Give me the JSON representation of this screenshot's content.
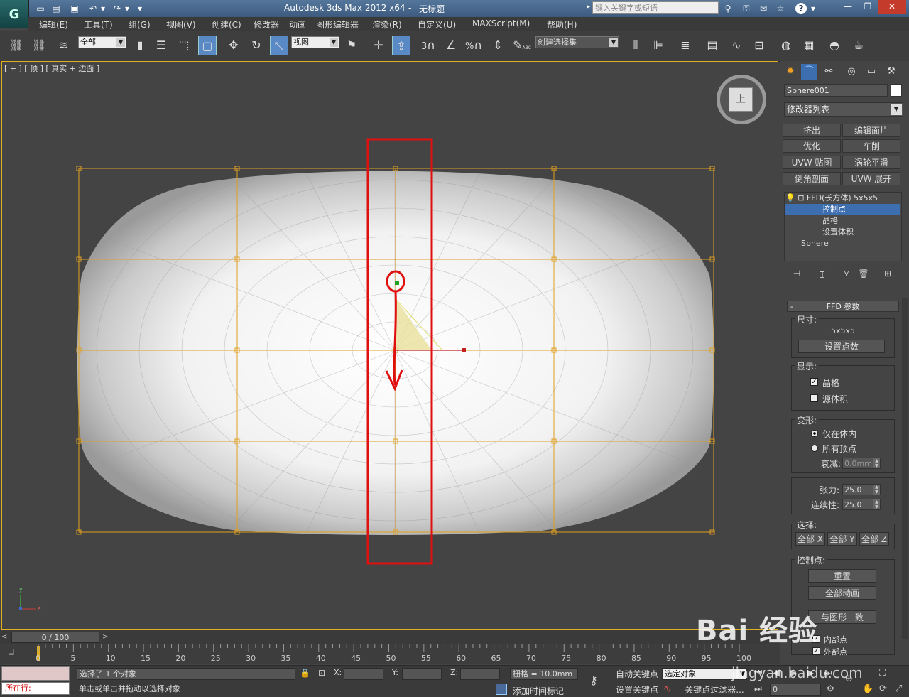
{
  "title_bar": {
    "app_title": "Autodesk 3ds Max  2012 x64",
    "separator": "-",
    "document_name": "无标题",
    "search_placeholder": "键入关键字或短语",
    "help_label": "?"
  },
  "menu": [
    "编辑(E)",
    "工具(T)",
    "组(G)",
    "视图(V)",
    "创建(C)",
    "修改器",
    "动画",
    "图形编辑器",
    "渲染(R)",
    "自定义(U)",
    "MAXScript(M)",
    "帮助(H)"
  ],
  "toolbar": {
    "selection_filter": "全部",
    "ref_coord": "视图",
    "snap_labels": [
      "3",
      "%"
    ],
    "named_selection": "创建选择集",
    "abc_label": "ABC"
  },
  "viewport": {
    "label": "[ + ] [ 顶 ] [ 真实 + 边面 ]",
    "viewcube_label": "上",
    "axis_labels": [
      "y",
      "x"
    ]
  },
  "command_panel": {
    "object_name": "Sphere001",
    "object_color": "#ffffff",
    "modifier_list": "修改器列表",
    "modifier_buttons": [
      "挤出",
      "编辑面片",
      "优化",
      "车削",
      "UVW 贴图",
      "涡轮平滑",
      "倒角剖面",
      "UVW 展开"
    ],
    "stack": {
      "modifier": "FFD(长方体) 5x5x5",
      "sub_objects": [
        "控制点",
        "晶格",
        "设置体积"
      ],
      "selected_sub": "控制点",
      "base": "Sphere"
    },
    "rollout_title": "FFD 参数",
    "dimensions": {
      "label": "尺寸:",
      "value": "5x5x5",
      "button": "设置点数"
    },
    "display": {
      "label": "显示:",
      "lattice": "晶格",
      "lattice_checked": true,
      "source_volume": "源体积",
      "source_checked": false
    },
    "deform": {
      "label": "变形:",
      "only_in_volume": "仅在体内",
      "all_vertices": "所有顶点",
      "falloff_label": "衰减:",
      "falloff": "0.0mm"
    },
    "tension_label": "张力:",
    "tension": "25.0",
    "continuity_label": "连续性:",
    "continuity": "25.0",
    "selection": {
      "label": "选择:",
      "buttons": [
        "全部 X",
        "全部 Y",
        "全部 Z"
      ]
    },
    "control_points": {
      "label": "控制点:",
      "reset": "重置",
      "animate_all": "全部动画",
      "conform": "与图形一致",
      "inside": "内部点",
      "outside": "外部点"
    }
  },
  "timeline": {
    "slider": "0 / 100",
    "ticks": [
      "0",
      "5",
      "10",
      "15",
      "20",
      "25",
      "30",
      "35",
      "40",
      "45",
      "50",
      "55",
      "60",
      "65",
      "70",
      "75",
      "80",
      "85",
      "90",
      "95",
      "100"
    ]
  },
  "status": {
    "listener_prompt": "所在行:",
    "selected": "选择了 1 个对象",
    "hint": "单击或单击并拖动以选择对象",
    "x_label": "X:",
    "y_label": "Y:",
    "z_label": "Z:",
    "grid": "栅格 = 10.0mm",
    "add_time_tag": "添加时间标记",
    "auto_key": "自动关键点",
    "set_key": "设置关键点",
    "key_mode": "选定对象",
    "key_filters": "关键点过滤器...",
    "frame": "0"
  },
  "watermark": {
    "text": "Bai 经验",
    "url": "jingyan.baidu.com"
  }
}
